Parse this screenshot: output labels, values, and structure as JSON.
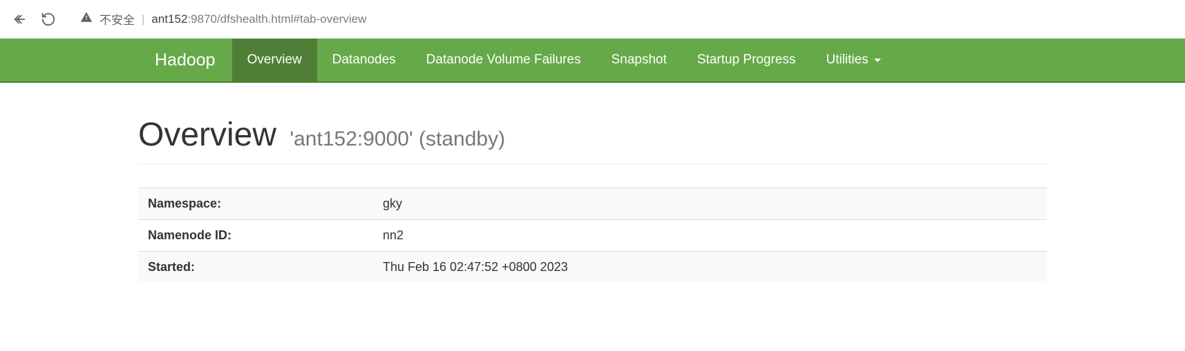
{
  "browser": {
    "insecure_label": "不安全",
    "url_host": "ant152",
    "url_port_path": ":9870/dfshealth.html#tab-overview"
  },
  "nav": {
    "brand": "Hadoop",
    "items": [
      "Overview",
      "Datanodes",
      "Datanode Volume Failures",
      "Snapshot",
      "Startup Progress"
    ],
    "utilities_label": "Utilities"
  },
  "page": {
    "title": "Overview",
    "subtitle": "'ant152:9000' (standby)"
  },
  "table": {
    "rows": [
      {
        "label": "Namespace:",
        "value": "gky"
      },
      {
        "label": "Namenode ID:",
        "value": "nn2"
      },
      {
        "label": "Started:",
        "value": "Thu Feb 16 02:47:52 +0800 2023"
      }
    ]
  }
}
